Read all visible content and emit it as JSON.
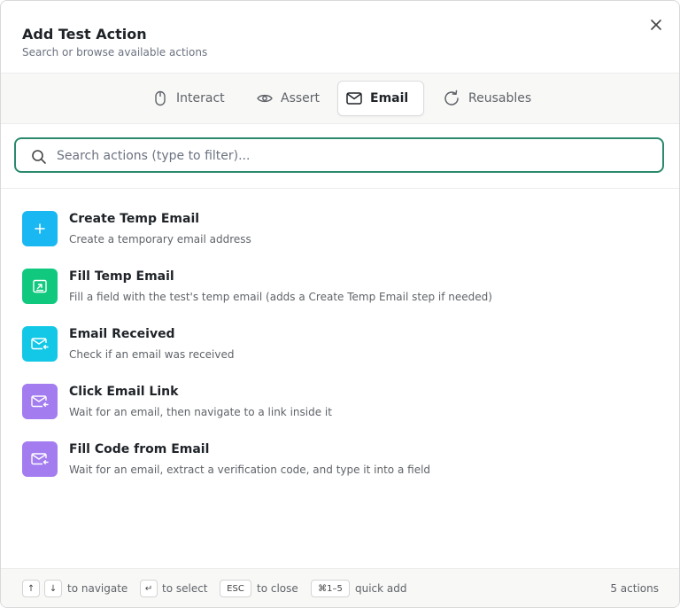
{
  "dialog": {
    "title": "Add Test Action",
    "subtitle": "Search or browse available actions",
    "close_icon": "close-icon"
  },
  "tabs": [
    {
      "label": "Interact",
      "icon": "mouse-icon",
      "active": false
    },
    {
      "label": "Assert",
      "icon": "eye-icon",
      "active": false
    },
    {
      "label": "Email",
      "icon": "envelope-icon",
      "active": true
    },
    {
      "label": "Reusables",
      "icon": "refresh-icon",
      "active": false
    }
  ],
  "search": {
    "placeholder": "Search actions (type to filter)...",
    "value": "",
    "icon": "search-icon",
    "focus_color": "#2b8a6e"
  },
  "actions": [
    {
      "title": "Create Temp Email",
      "description": "Create a temporary email address",
      "icon": "plus-icon",
      "color": "#1ab8f3"
    },
    {
      "title": "Fill Temp Email",
      "description": "Fill a field with the test's temp email (adds a Create Temp Email step if needed)",
      "icon": "fill-field-icon",
      "color": "#10c97f"
    },
    {
      "title": "Email Received",
      "description": "Check if an email was received",
      "icon": "mail-received-icon",
      "color": "#12c8e6"
    },
    {
      "title": "Click Email Link",
      "description": "Wait for an email, then navigate to a link inside it",
      "icon": "mail-link-icon",
      "color": "#a37cf0"
    },
    {
      "title": "Fill Code from Email",
      "description": "Wait for an email, extract a verification code, and type it into a field",
      "icon": "mail-code-icon",
      "color": "#a37cf0"
    }
  ],
  "footer": {
    "keys": {
      "up": "↑",
      "down": "↓",
      "enter": "↵",
      "esc": "ESC",
      "quick": "⌘1–5"
    },
    "hints": {
      "navigate": "to navigate",
      "select": "to select",
      "close": "to close",
      "quick_add": "quick add"
    },
    "count": "5 actions"
  }
}
